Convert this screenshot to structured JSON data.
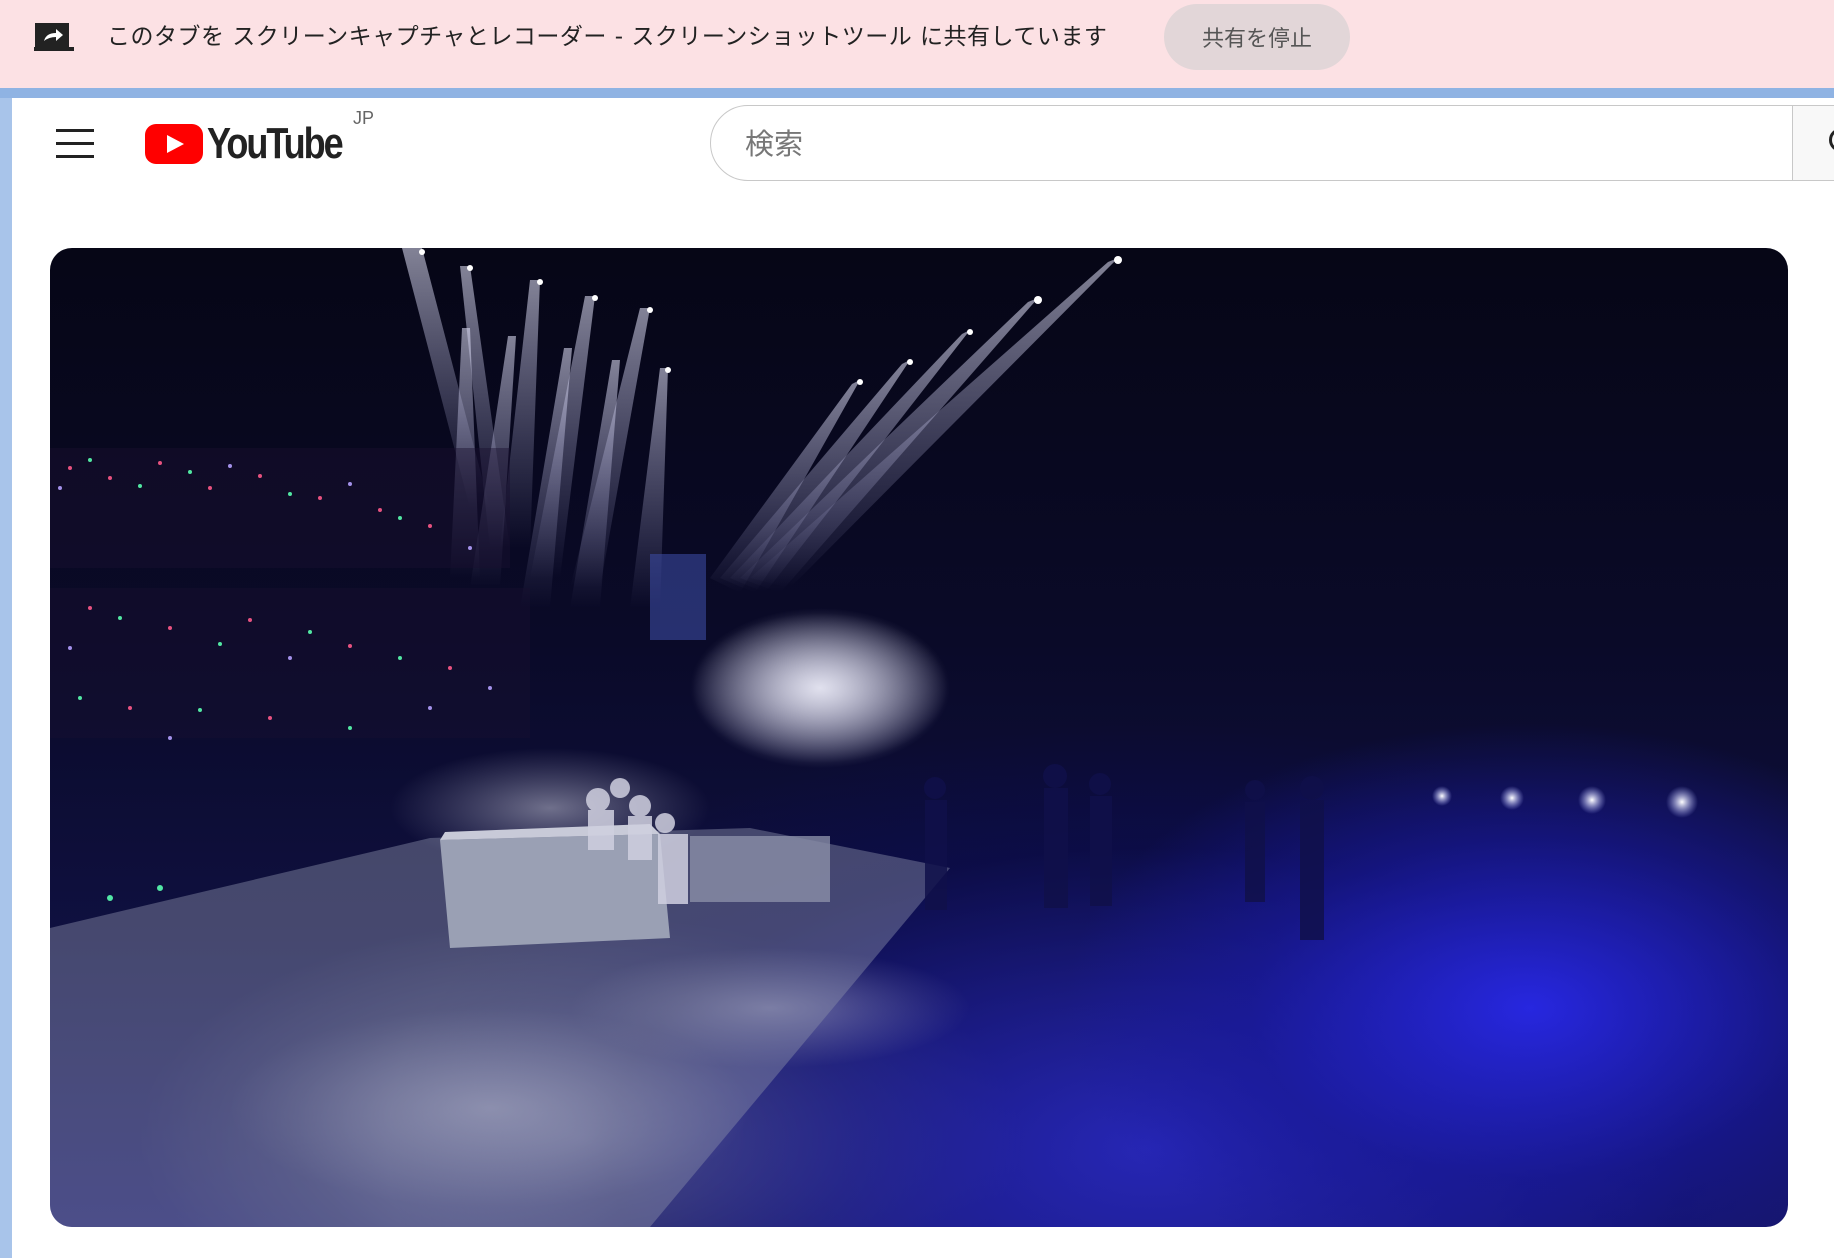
{
  "share_bar": {
    "message": "このタブを スクリーンキャプチャとレコーダー - スクリーンショットツール に共有しています",
    "stop_label": "共有を停止",
    "icon": "share-screen-icon",
    "background": "#fce1e4"
  },
  "header": {
    "menu_icon": "hamburger-menu-icon",
    "logo_text": "YouTube",
    "logo_region": "JP",
    "search": {
      "placeholder": "検索",
      "value": ""
    },
    "search_button_icon": "search-icon"
  },
  "player": {
    "description": "",
    "accent": "#2a2ae0"
  },
  "colors": {
    "brand_red": "#ff0000",
    "tab_strip": "#8fb3e3"
  }
}
